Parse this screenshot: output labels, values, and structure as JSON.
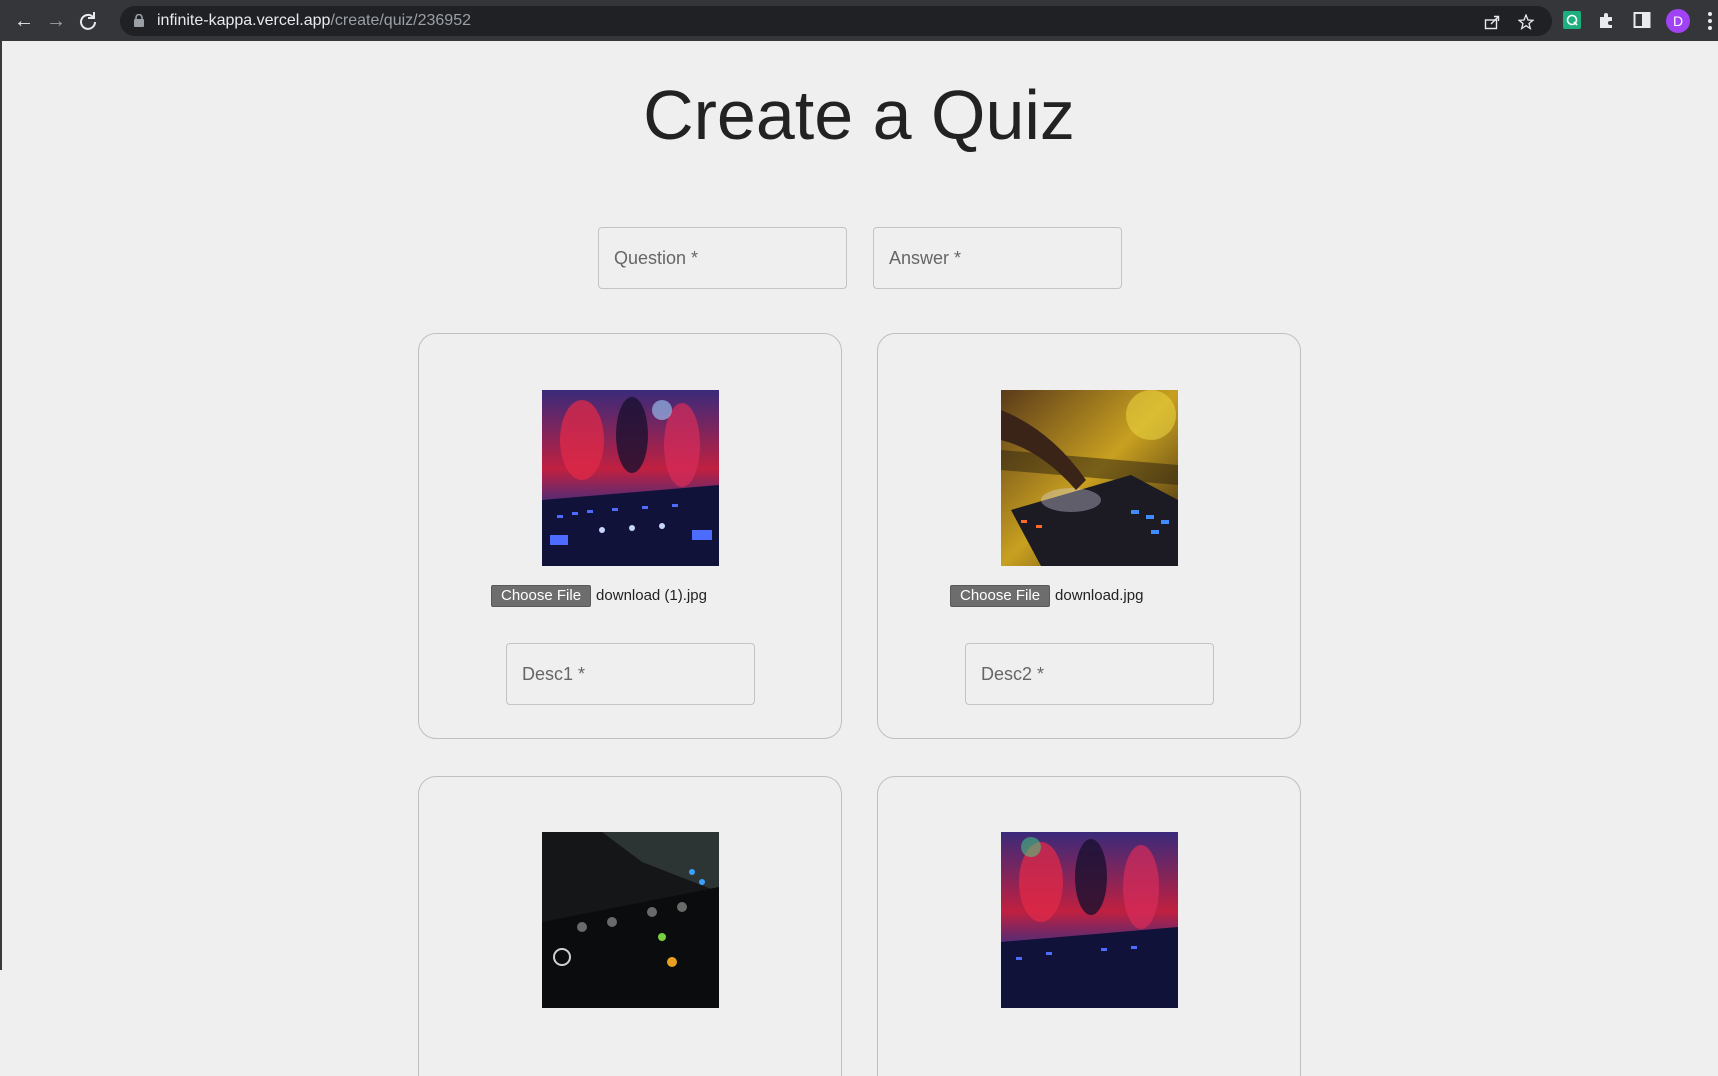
{
  "browser": {
    "url_host": "infinite-kappa.vercel.app",
    "url_path": "/create/quiz/236952",
    "avatar_letter": "D",
    "back_icon": "arrow-left-icon",
    "forward_icon": "arrow-right-icon",
    "reload_icon": "reload-icon"
  },
  "page": {
    "title": "Create a Quiz",
    "question_placeholder": "Question *",
    "answer_placeholder": "Answer *"
  },
  "cards": [
    {
      "choose_label": "Choose File",
      "file_name": "download (1).jpg",
      "desc_placeholder": "Desc1 *"
    },
    {
      "choose_label": "Choose File",
      "file_name": "download.jpg",
      "desc_placeholder": "Desc2 *"
    }
  ],
  "colors": {
    "page_bg": "#efefef",
    "chrome_bg": "#35363a",
    "omnibox_bg": "#202124",
    "button_bg": "#6d6d6d",
    "avatar": "#a142f4"
  }
}
